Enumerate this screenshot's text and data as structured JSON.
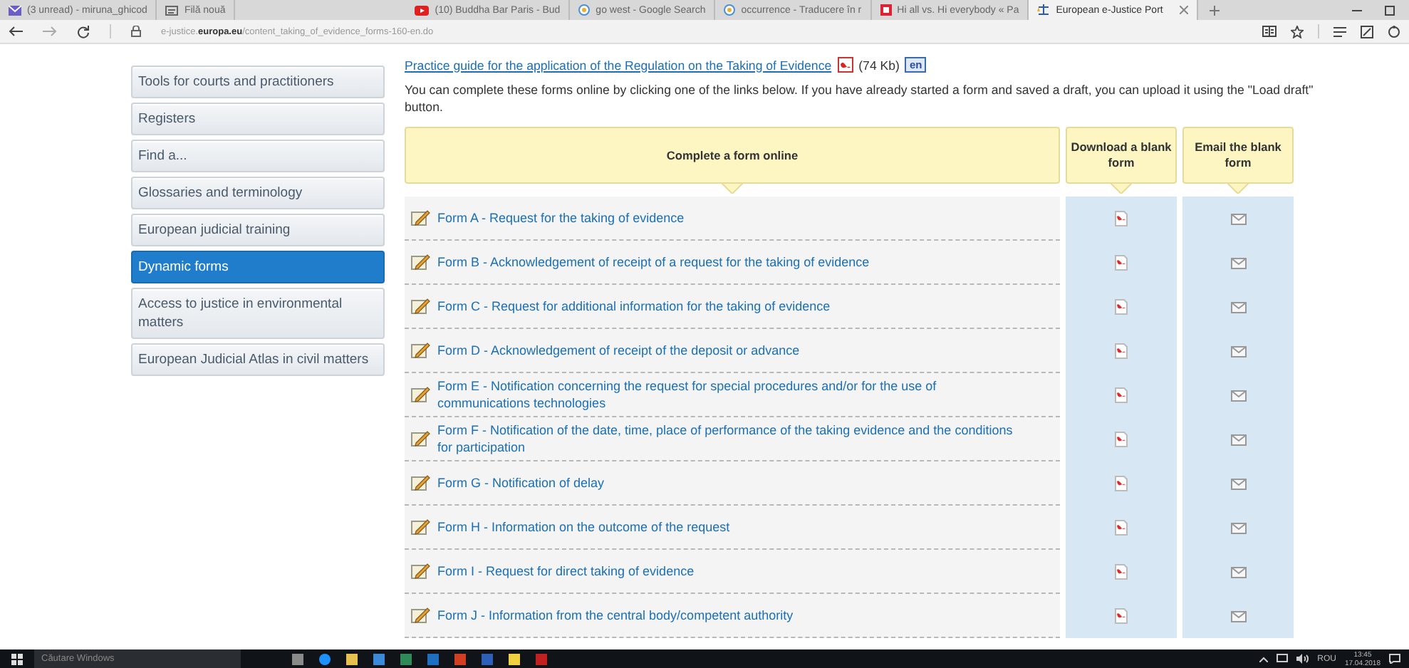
{
  "browser": {
    "tabs": [
      {
        "title": "(3 unread) - miruna_ghicod",
        "selected": false
      },
      {
        "title": "Filă nouă",
        "selected": false
      },
      {
        "title": "(10) Buddha Bar Paris - Bud",
        "selected": false
      },
      {
        "title": "go west - Google Search",
        "selected": false
      },
      {
        "title": "occurrence - Traducere în r",
        "selected": false
      },
      {
        "title": "Hi all vs. Hi everybody « Pa",
        "selected": false
      },
      {
        "title": "European e-Justice Port",
        "selected": true
      }
    ],
    "address": "e-justice.**europa.eu**/content_taking_of_evidence_forms-160-en.do"
  },
  "sidebar": {
    "items": [
      {
        "label": "Tools for courts and practitioners",
        "selected": false
      },
      {
        "label": "Registers",
        "selected": false
      },
      {
        "label": "Find a...",
        "selected": false
      },
      {
        "label": "Glossaries and terminology",
        "selected": false
      },
      {
        "label": "European judicial training",
        "selected": false
      },
      {
        "label": "Dynamic forms",
        "selected": true
      },
      {
        "label": "Access to justice in environmental matters",
        "selected": false
      },
      {
        "label": "European Judicial Atlas in civil matters",
        "selected": false
      }
    ]
  },
  "content": {
    "guide_link": "Practice guide for the application of the Regulation on the Taking of Evidence",
    "guide_size": "(74 Kb)",
    "guide_lang": "en",
    "intro": "You can complete these forms online by clicking one of the links below. If you have already started a form and saved a draft, you can upload it using the \"Load draft\" button.",
    "table": {
      "columns": [
        "Complete a form online",
        "Download a blank form",
        "Email the blank form"
      ],
      "rows": [
        {
          "form": "Form A - Request for the taking of evidence"
        },
        {
          "form": "Form B - Acknowledgement of receipt of a request for the taking of evidence"
        },
        {
          "form": "Form C - Request for additional information for the taking of evidence"
        },
        {
          "form": "Form D - Acknowledgement of receipt of the deposit or advance"
        },
        {
          "form": "Form E - Notification concerning the request for special procedures and/or for the use of communications technologies"
        },
        {
          "form": "Form F - Notification of the date, time, place of performance of the taking evidence and the conditions for participation"
        },
        {
          "form": "Form G - Notification of delay"
        },
        {
          "form": "Form H - Information on the outcome of the request"
        },
        {
          "form": "Form I - Request for direct taking of evidence"
        },
        {
          "form": "Form J - Information from the central body/competent authority"
        }
      ]
    }
  },
  "taskbar": {
    "search": "Căutare Windows",
    "language": "ROU",
    "time": "13:45",
    "date": "17.04.2018"
  }
}
